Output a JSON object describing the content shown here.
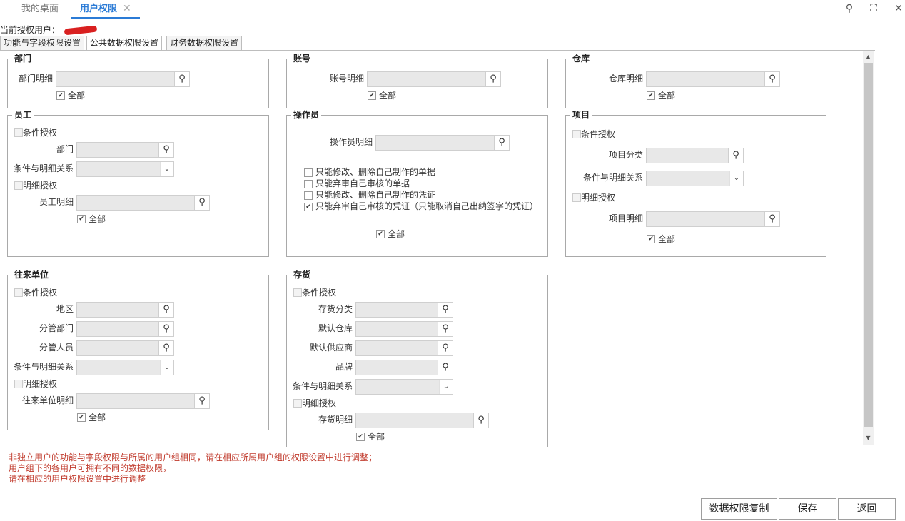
{
  "tabs": {
    "home": "我的桌面",
    "active": "用户权限",
    "close": "✕"
  },
  "window": {
    "search_glyph": "⚲",
    "maximize_glyph": "⛶",
    "close_glyph": "✕"
  },
  "current_user": {
    "label": "当前授权用户："
  },
  "subtabs": [
    "功能与字段权限设置",
    "公共数据权限设置",
    "财务数据权限设置"
  ],
  "common": {
    "all": "全部",
    "check": "✔",
    "search_glyph": "⚲",
    "dropdown_glyph": "⌄"
  },
  "dept": {
    "title": "部门",
    "detail": "部门明细"
  },
  "account": {
    "title": "账号",
    "detail": "账号明细"
  },
  "warehouse": {
    "title": "仓库",
    "detail": "仓库明细"
  },
  "employee": {
    "title": "员工",
    "cond_auth": "条件授权",
    "dept": "部门",
    "relation": "条件与明细关系",
    "detail_auth": "明细授权",
    "detail": "员工明细"
  },
  "operator": {
    "title": "操作员",
    "detail": "操作员明细",
    "options": [
      "只能修改、删除自己制作的单据",
      "只能弃审自己审核的单据",
      "只能修改、删除自己制作的凭证",
      "只能弃审自己审核的凭证（只能取消自己出纳签字的凭证）"
    ],
    "options_checked": [
      false,
      false,
      false,
      true
    ]
  },
  "project": {
    "title": "项目",
    "cond_auth": "条件授权",
    "category": "项目分类",
    "relation": "条件与明细关系",
    "detail_auth": "明细授权",
    "detail": "项目明细"
  },
  "partner": {
    "title": "往来单位",
    "cond_auth": "条件授权",
    "region": "地区",
    "mgr_dept": "分管部门",
    "mgr_person": "分管人员",
    "relation": "条件与明细关系",
    "detail_auth": "明细授权",
    "detail": "往来单位明细"
  },
  "inventory": {
    "title": "存货",
    "cond_auth": "条件授权",
    "category": "存货分类",
    "default_wh": "默认仓库",
    "default_supplier": "默认供应商",
    "brand": "品牌",
    "relation": "条件与明细关系",
    "detail_auth": "明细授权",
    "detail": "存货明细"
  },
  "notes": [
    "非独立用户的功能与字段权限与所属的用户组相同，请在相应所属用户组的权限设置中进行调整；",
    "用户组下的各用户可拥有不同的数据权限，",
    "请在相应的用户权限设置中进行调整"
  ],
  "buttons": {
    "copy": "数据权限复制",
    "save": "保存",
    "back": "返回"
  },
  "colors": {
    "accent": "#2b7bd6",
    "note": "#c0392b"
  }
}
